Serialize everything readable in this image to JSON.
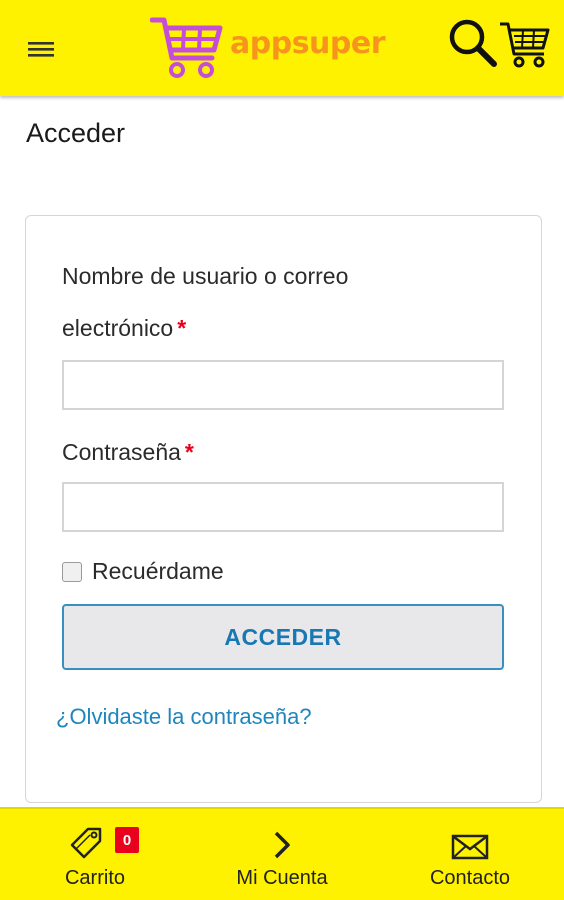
{
  "header": {
    "brand_name": "appsuper",
    "brand_color": "#f7941d",
    "background_color": "#fff200",
    "icons": [
      "menu-icon",
      "cart-logo-icon",
      "search-icon",
      "cart-icon"
    ]
  },
  "page": {
    "title": "Acceder"
  },
  "form": {
    "username_label_line1": "Nombre de usuario o correo",
    "username_label_line2": "electrónico",
    "required_mark": "*",
    "username_value": "",
    "password_label": "Contraseña",
    "password_value": "",
    "remember_label": "Recuérdame",
    "remember_checked": false,
    "submit_label": "ACCEDER",
    "forgot_link": "¿Olvidaste la contraseña?",
    "accent_color": "#1f86bd",
    "required_color": "#e8001c"
  },
  "bottom_nav": {
    "items": [
      {
        "label": "Carrito",
        "icon": "tag-icon",
        "badge": "0"
      },
      {
        "label": "Mi Cuenta",
        "icon": "chevron-right-icon"
      },
      {
        "label": "Contacto",
        "icon": "envelope-icon"
      }
    ]
  }
}
